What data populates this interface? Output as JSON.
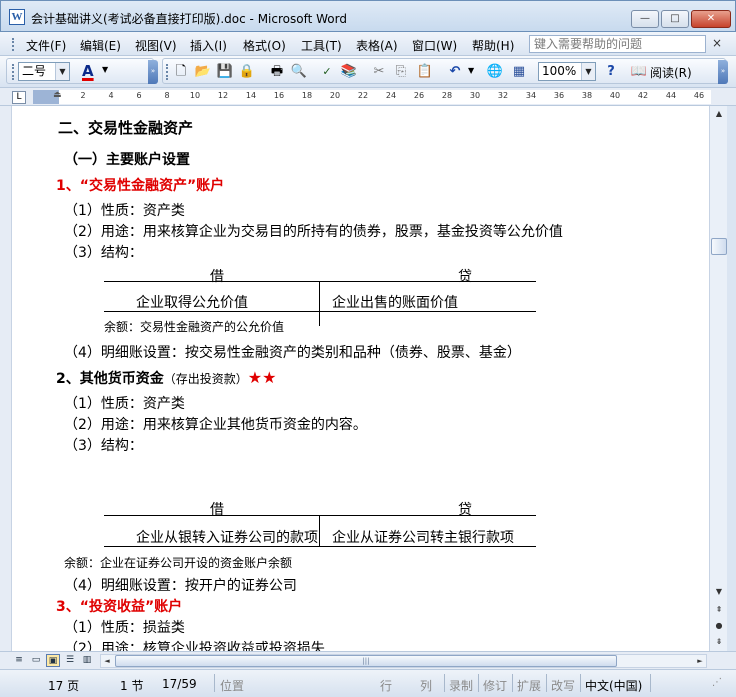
{
  "window": {
    "title": "会计基础讲义(考试必备直接打印版).doc - Microsoft Word",
    "app_icon": "W",
    "buttons": {
      "minimize": "—",
      "maximize": "□",
      "close": "✕"
    }
  },
  "menu": {
    "items": [
      "文件(F)",
      "编辑(E)",
      "视图(V)",
      "插入(I)",
      "格式(O)",
      "工具(T)",
      "表格(A)",
      "窗口(W)",
      "帮助(H)"
    ],
    "help_placeholder": "键入需要帮助的问题",
    "close_glyph": "×"
  },
  "toolbar": {
    "font_size": "二号",
    "font_color_label": "A",
    "zoom": "100%",
    "read_label": "阅读(R)",
    "icons": [
      "new-icon",
      "open-icon",
      "save-icon",
      "permission-icon",
      "print-icon",
      "print-preview-icon",
      "spelling-icon",
      "research-icon",
      "cut-icon",
      "copy-icon",
      "paste-icon",
      "undo-icon",
      "hyperlink-icon",
      "table-icon",
      "help-icon",
      "read-icon"
    ],
    "accent_color": "#e00000"
  },
  "ruler": {
    "tab_selector": "L",
    "numbers": [
      "2",
      "4",
      "6",
      "8",
      "10",
      "12",
      "14",
      "16",
      "18",
      "20",
      "22",
      "24",
      "26",
      "28",
      "30",
      "32",
      "34",
      "36",
      "38",
      "40",
      "42",
      "44",
      "46"
    ]
  },
  "document": {
    "heading_section": "二、交易性金融资产",
    "heading_sub": "（一）主要账户设置",
    "account1_title": "1、“交易性金融资产”账户",
    "a1_line1": "（1）性质：资产类",
    "a1_line2": "（2）用途：用来核算企业为交易目的所持有的债券，股票，基金投资等公允价值",
    "a1_line3": "（3）结构：",
    "t1": {
      "debit": "借",
      "credit": "贷",
      "left": "企业取得公允价值",
      "right": "企业出售的账面价值",
      "balance": "余额：交易性金融资产的公允价值"
    },
    "a1_line4": "（4）明细账设置：按交易性金融资产的类别和品种（债券、股票、基金）",
    "account2_title": "2、其他货币资金",
    "account2_note": "（存出投资款）",
    "account2_stars": "★★",
    "a2_line1": "（1）性质：资产类",
    "a2_line2": "（2）用途：用来核算企业其他货币资金的内容。",
    "a2_line3": "（3）结构：",
    "t2": {
      "debit": "借",
      "credit": "贷",
      "left": "企业从银转入证券公司的款项",
      "right": "企业从证券公司转主银行款项",
      "balance": "余额：企业在证券公司开设的资金账户余额"
    },
    "a2_line4": "（4）明细账设置：按开户的证券公司",
    "account3_title": "3、“投资收益”账户",
    "a3_line1": "（1）性质：损益类",
    "a3_line2": "（2）用途：核算企业投资收益或投资损失"
  },
  "scrollbar": {
    "up": "▲",
    "down": "▼",
    "prev_page": "⇞",
    "browse": "●",
    "next_page": "⇟"
  },
  "views": [
    "≡",
    "▭",
    "▣",
    "☰",
    "▥"
  ],
  "statusbar": {
    "page": "17 页",
    "section": "1 节",
    "pages": "17/59",
    "position": "位置",
    "line": "行",
    "column": "列",
    "rec": "录制",
    "trk": "修订",
    "ext": "扩展",
    "ovr": "改写",
    "language": "中文(中国)"
  }
}
